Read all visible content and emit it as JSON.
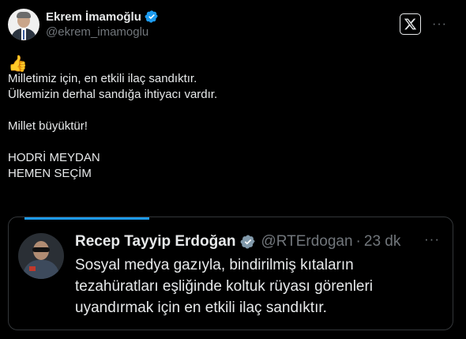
{
  "author": {
    "display_name": "Ekrem İmamoğlu",
    "handle": "@ekrem_imamoglu",
    "verified": true
  },
  "icons": {
    "x_logo": "x-logo-icon",
    "more": "more-options-icon",
    "verified": "verified-badge-icon"
  },
  "more_glyph": "···",
  "tweet": {
    "emoji": "👍",
    "lines": [
      "Milletimiz için, en etkili ilaç sandıktır.",
      "Ülkemizin derhal sandığa ihtiyacı vardır.",
      "",
      "Millet büyüktür!",
      "",
      "HODRİ MEYDAN",
      "HEMEN SEÇİM"
    ]
  },
  "quoted": {
    "display_name": "Recep Tayyip Erdoğan",
    "handle": "@RTErdogan",
    "separator": "·",
    "time": "23 dk",
    "lines": [
      "Sosyal medya gazıyla, bindirilmiş kıtaların",
      "tezahüratları eşliğinde koltuk rüyası görenleri",
      "uyandırmak için en etkili ilaç sandıktır."
    ]
  },
  "colors": {
    "background": "#000000",
    "text": "#e7e9ea",
    "secondary": "#71767b",
    "accent": "#1d9bf0",
    "border": "#333639"
  }
}
